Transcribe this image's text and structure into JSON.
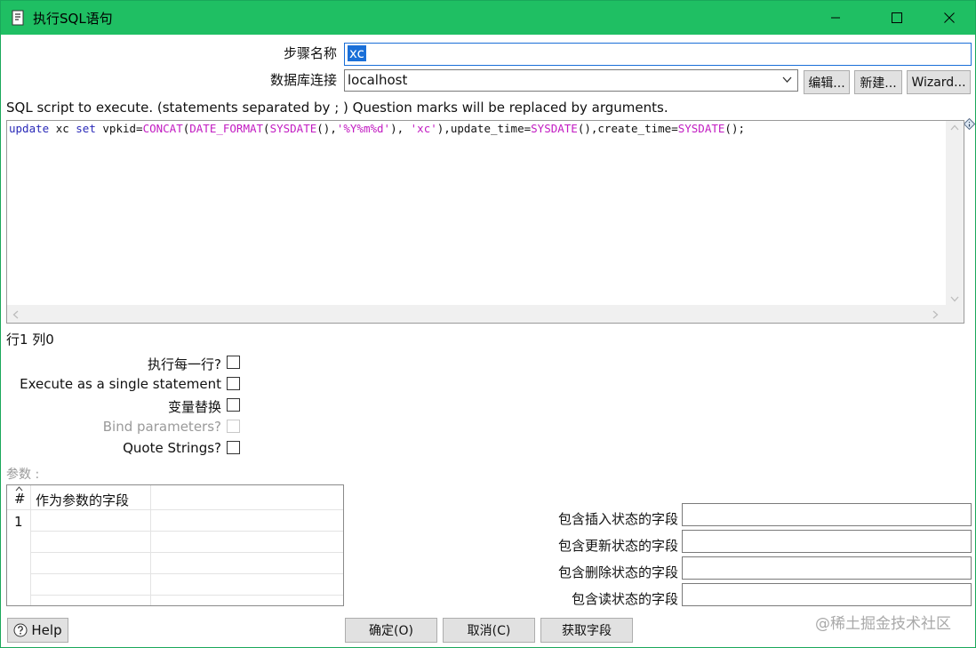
{
  "window": {
    "title": "执行SQL语句"
  },
  "form": {
    "step_name_label": "步骤名称",
    "step_name_value": "xc",
    "db_conn_label": "数据库连接",
    "db_conn_value": "localhost",
    "edit_button": "编辑...",
    "new_button": "新建...",
    "wizard_button": "Wizard..."
  },
  "sql": {
    "description": "SQL script to execute. (statements separated by ; ) Question marks will be replaced by arguments.",
    "script": "update xc set vpkid=CONCAT(DATE_FORMAT(SYSDATE(),'%Y%m%d'), 'xc'),update_time=SYSDATE(),create_time=SYSDATE();",
    "cursor_position": "行1 列0"
  },
  "options": {
    "execute_each_row": "执行每一行?",
    "single_statement": "Execute as a single statement",
    "variable_substitution": "变量替换",
    "bind_parameters": "Bind parameters?",
    "quote_strings": "Quote Strings?"
  },
  "params": {
    "label": "参数 :",
    "columns": [
      "#",
      "作为参数的字段"
    ],
    "rows": [
      [
        "1",
        ""
      ]
    ]
  },
  "status_fields": {
    "insert_label": "包含插入状态的字段",
    "update_label": "包含更新状态的字段",
    "delete_label": "包含删除状态的字段",
    "read_label": "包含读状态的字段"
  },
  "footer": {
    "help_button": "Help",
    "ok_button": "确定(O)",
    "cancel_button": "取消(C)",
    "get_fields_button": "获取字段",
    "watermark": "@稀土掘金技术社区"
  },
  "colors": {
    "titlebar": "#1fbf63",
    "selection": "#1a6fd8",
    "sql_keyword": "#2a2ab8",
    "sql_function": "#c21cc2"
  }
}
